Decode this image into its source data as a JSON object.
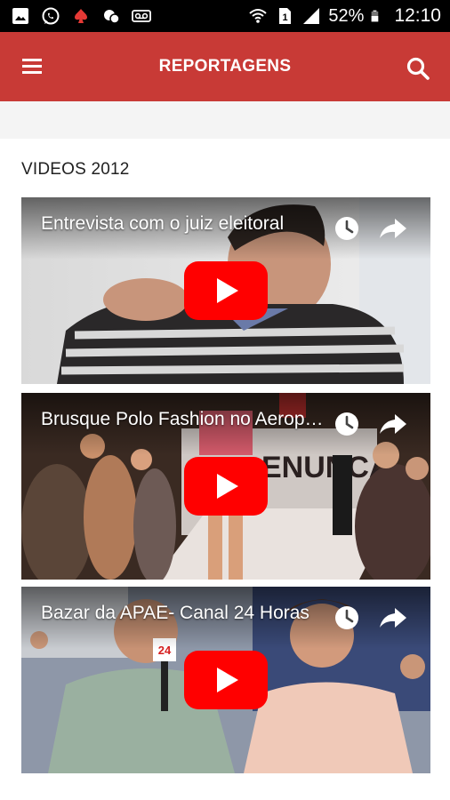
{
  "status_bar": {
    "battery_percent": "52%",
    "time": "12:10",
    "icons": [
      "gallery-icon",
      "whatsapp-icon",
      "poker-icon",
      "chat-icon",
      "voicemail-icon",
      "wifi-icon",
      "sim-icon",
      "signal-icon",
      "battery-icon"
    ]
  },
  "app_bar": {
    "title": "REPORTAGENS",
    "background": "#c83a36",
    "icons": [
      "menu-icon",
      "search-icon"
    ]
  },
  "section": {
    "title": "VIDEOS 2012"
  },
  "videos": [
    {
      "title": "Entrevista com o juiz eleitoral",
      "thumbnail": "man-in-striped-sweater"
    },
    {
      "title": "Brusque Polo Fashion no Aeroporto",
      "thumbnail": "fashion-runway"
    },
    {
      "title": "Bazar da APAE- Canal 24 Horas",
      "thumbnail": "interview-at-bazaar"
    }
  ],
  "colors": {
    "play_button": "#ff0000",
    "accent": "#c83a36"
  }
}
